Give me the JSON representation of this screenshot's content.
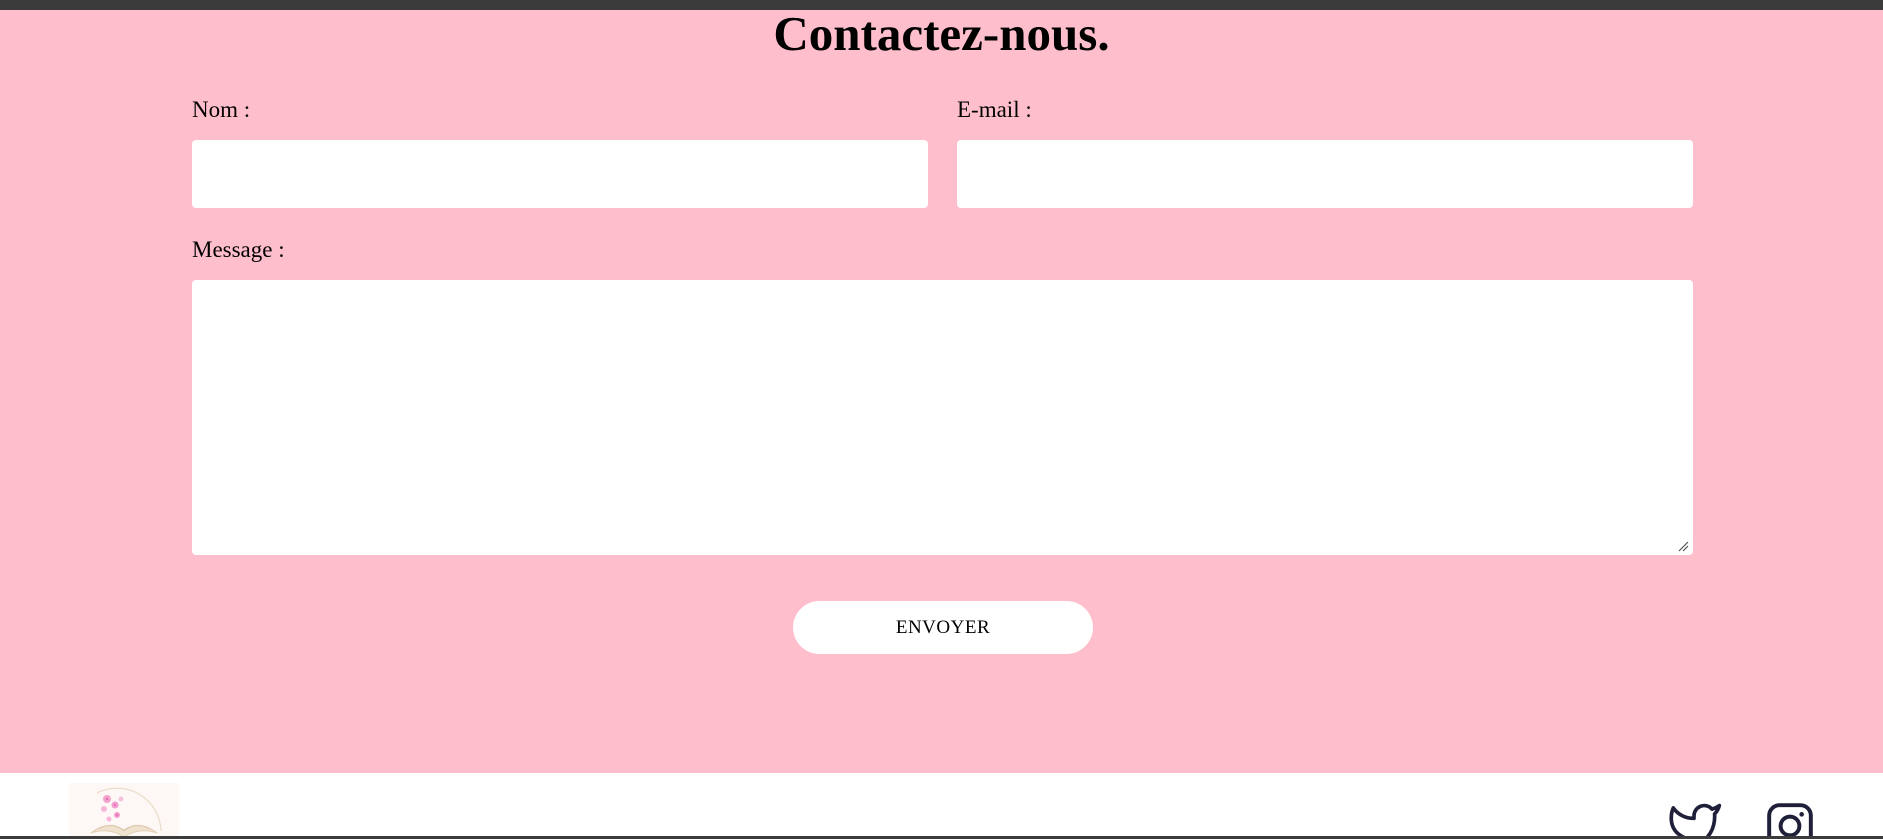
{
  "contact": {
    "title": "Contactez-nous.",
    "name_label": "Nom :",
    "email_label": "E-mail :",
    "message_label": "Message :",
    "name_value": "",
    "email_value": "",
    "message_value": "",
    "submit_label": "ENVOYER"
  },
  "footer": {
    "logo_icon": "flower-book-logo",
    "social": [
      {
        "icon": "twitter-icon"
      },
      {
        "icon": "instagram-icon"
      }
    ]
  },
  "colors": {
    "section_background": "#ffbecb",
    "field_background": "#ffffff",
    "top_bar": "#3b3b3b",
    "icon_color": "#1f1f3a"
  }
}
